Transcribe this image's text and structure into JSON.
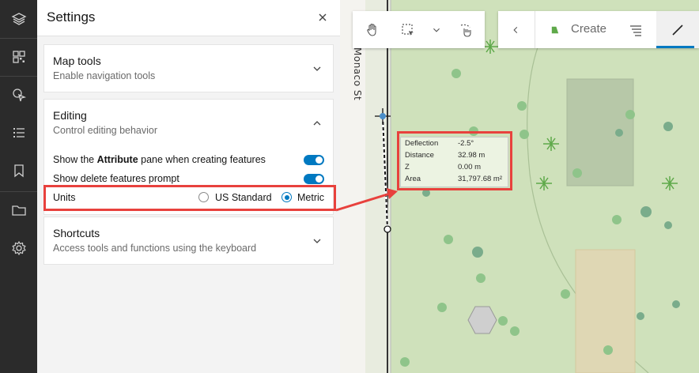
{
  "rail": {
    "items": [
      {
        "icon": "layers-icon"
      },
      {
        "icon": "basemap-grid-icon"
      },
      {
        "icon": "select-cursor-icon"
      },
      {
        "icon": "list-icon"
      },
      {
        "icon": "bookmark-icon"
      },
      {
        "icon": "folder-icon"
      },
      {
        "icon": "gear-icon"
      }
    ]
  },
  "settings": {
    "title": "Settings",
    "close_icon": "close-icon",
    "map_tools": {
      "title": "Map tools",
      "subtitle": "Enable navigation tools"
    },
    "editing": {
      "title": "Editing",
      "subtitle": "Control editing behavior",
      "attribute_prefix": "Show the ",
      "attribute_bold": "Attribute",
      "attribute_suffix": " pane when creating features",
      "attribute_toggle": true,
      "delete_prompt_label": "Show delete features prompt",
      "delete_prompt_toggle": true,
      "units_label": "Units",
      "units_options": [
        "US Standard",
        "Metric"
      ],
      "units_selected": "Metric"
    },
    "shortcuts": {
      "title": "Shortcuts",
      "subtitle": "Access tools and functions using the keyboard"
    }
  },
  "toolbar": {
    "tools": [
      "pan-hand-icon",
      "rectangle-select-icon",
      "chevron-down-icon",
      "lasso-select-icon"
    ],
    "create_label": "Create",
    "back_icon": "chevron-left-icon",
    "list_icon": "list-options-icon",
    "line_icon": "line-draw-icon"
  },
  "map": {
    "street_label": "Monaco St",
    "tooltip": {
      "rows": [
        {
          "label": "Deflection",
          "value": "-2.5°"
        },
        {
          "label": "Distance",
          "value": "32.98 m"
        },
        {
          "label": "Z",
          "value": "0.00 m"
        },
        {
          "label": "Area",
          "value": "31,797.68 m²"
        }
      ]
    }
  },
  "colors": {
    "accent": "#0079c1",
    "highlight": "#e8413d",
    "rail": "#2b2b2b",
    "map_green": "#cfe1bb"
  }
}
